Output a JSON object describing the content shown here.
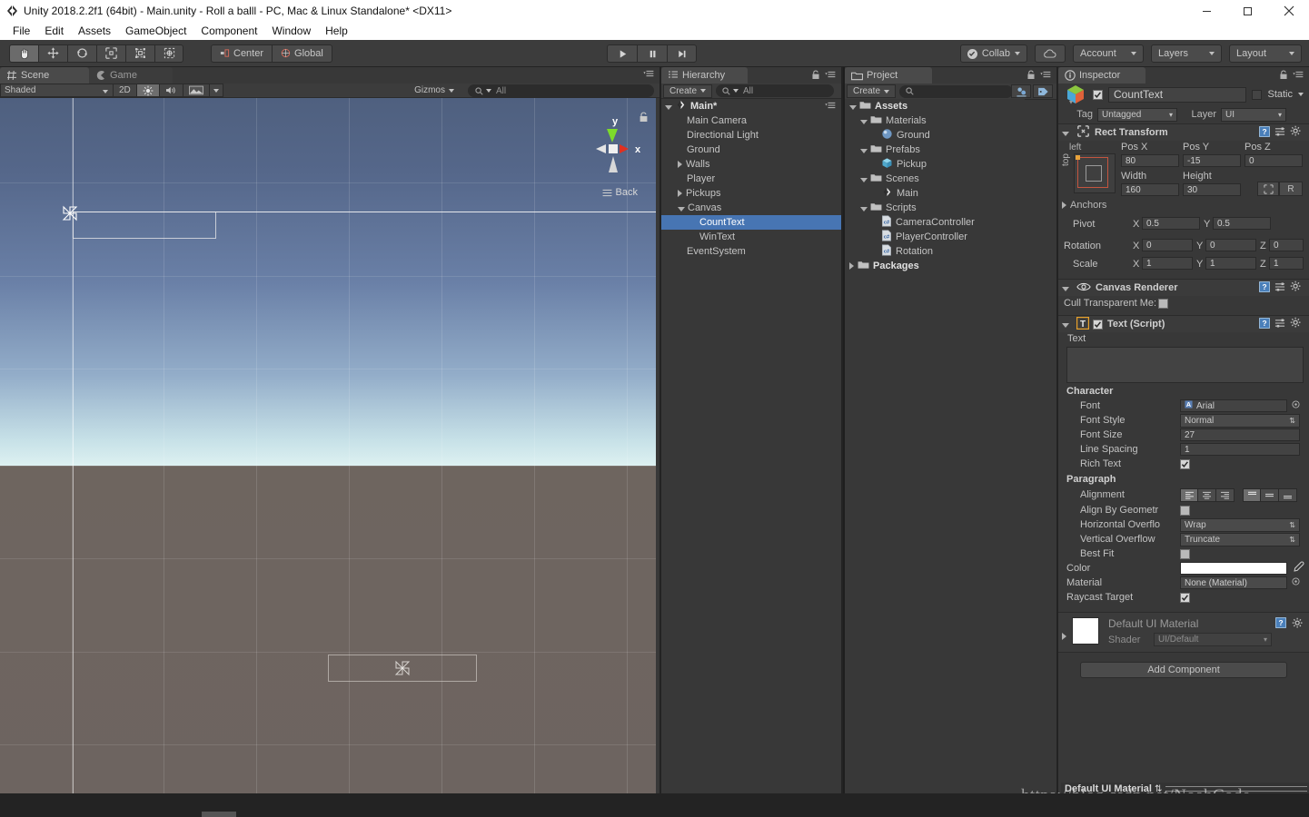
{
  "window": {
    "title": "Unity 2018.2.2f1 (64bit) - Main.unity - Roll a balll - PC, Mac & Linux Standalone* <DX11>",
    "app_icon": "unity-icon",
    "minimize": "minimize-icon",
    "maximize": "maximize-icon",
    "close": "close-icon"
  },
  "menubar": {
    "items": [
      {
        "label": "File"
      },
      {
        "label": "Edit"
      },
      {
        "label": "Assets"
      },
      {
        "label": "GameObject"
      },
      {
        "label": "Component"
      },
      {
        "label": "Window"
      },
      {
        "label": "Help"
      }
    ]
  },
  "toolbar": {
    "tools": [
      {
        "name": "hand-tool",
        "active": true
      },
      {
        "name": "move-tool",
        "active": false
      },
      {
        "name": "rotate-tool",
        "active": false
      },
      {
        "name": "scale-tool",
        "active": false
      },
      {
        "name": "rect-tool",
        "active": false
      },
      {
        "name": "transform-tool",
        "active": false
      }
    ],
    "pivot_label": "Center",
    "space_label": "Global",
    "play": "play-icon",
    "pause": "pause-icon",
    "step": "step-icon",
    "collab_label": "Collab",
    "cloud": "cloud-icon",
    "account_label": "Account",
    "layers_label": "Layers",
    "layout_label": "Layout"
  },
  "scene": {
    "tabs": [
      {
        "label": "Scene",
        "icon": "scene-grid-icon",
        "active": true
      },
      {
        "label": "Game",
        "icon": "game-pacman-icon",
        "active": false
      }
    ],
    "draw_mode": "Shaded",
    "mode_2d": "2D",
    "lighting": "sun-icon",
    "audio": "speaker-icon",
    "fx": "image-icon",
    "gizmos_label": "Gizmos",
    "search_placeholder": "All",
    "orientation_label": "Back",
    "axis_y": "y",
    "axis_x": "x"
  },
  "hierarchy": {
    "tab_label": "Hierarchy",
    "create_label": "Create",
    "search_placeholder": "All",
    "items": [
      {
        "label": "Main*",
        "depth": 0,
        "arrow": "open",
        "icon": "unity-scene-icon",
        "selected": false,
        "bold": true
      },
      {
        "label": "Main Camera",
        "depth": 1,
        "arrow": "none",
        "selected": false
      },
      {
        "label": "Directional Light",
        "depth": 1,
        "arrow": "none",
        "selected": false
      },
      {
        "label": "Ground",
        "depth": 1,
        "arrow": "none",
        "selected": false
      },
      {
        "label": "Walls",
        "depth": 1,
        "arrow": "closed",
        "selected": false
      },
      {
        "label": "Player",
        "depth": 1,
        "arrow": "none",
        "selected": false
      },
      {
        "label": "Pickups",
        "depth": 1,
        "arrow": "closed",
        "selected": false
      },
      {
        "label": "Canvas",
        "depth": 1,
        "arrow": "open",
        "selected": false
      },
      {
        "label": "CountText",
        "depth": 2,
        "arrow": "none",
        "selected": true
      },
      {
        "label": "WinText",
        "depth": 2,
        "arrow": "none",
        "selected": false
      },
      {
        "label": "EventSystem",
        "depth": 1,
        "arrow": "none",
        "selected": false
      }
    ]
  },
  "project": {
    "tab_label": "Project",
    "create_label": "Create",
    "search_placeholder": "",
    "items": [
      {
        "label": "Assets",
        "depth": 0,
        "arrow": "open",
        "icon": "folder-icon",
        "bold": true
      },
      {
        "label": "Materials",
        "depth": 1,
        "arrow": "open",
        "icon": "folder-icon"
      },
      {
        "label": "Ground",
        "depth": 2,
        "arrow": "none",
        "icon": "material-sphere-icon"
      },
      {
        "label": "Prefabs",
        "depth": 1,
        "arrow": "open",
        "icon": "folder-icon"
      },
      {
        "label": "Pickup",
        "depth": 2,
        "arrow": "none",
        "icon": "prefab-cube-icon"
      },
      {
        "label": "Scenes",
        "depth": 1,
        "arrow": "open",
        "icon": "folder-icon"
      },
      {
        "label": "Main",
        "depth": 2,
        "arrow": "none",
        "icon": "unity-scene-icon"
      },
      {
        "label": "Scripts",
        "depth": 1,
        "arrow": "open",
        "icon": "folder-icon"
      },
      {
        "label": "CameraController",
        "depth": 2,
        "arrow": "none",
        "icon": "csharp-script-icon"
      },
      {
        "label": "PlayerController",
        "depth": 2,
        "arrow": "none",
        "icon": "csharp-script-icon"
      },
      {
        "label": "Rotation",
        "depth": 2,
        "arrow": "none",
        "icon": "csharp-script-icon"
      },
      {
        "label": "Packages",
        "depth": 0,
        "arrow": "closed",
        "icon": "folder-icon",
        "bold": true
      }
    ]
  },
  "inspector": {
    "tab_label": "Inspector",
    "object_name": "CountText",
    "object_enabled": true,
    "static_label": "Static",
    "tag_label": "Tag",
    "tag_value": "Untagged",
    "layer_label": "Layer",
    "layer_value": "UI",
    "rect_transform": {
      "title": "Rect Transform",
      "anchor_h_label": "left",
      "anchor_v_label": "top",
      "pos_x_label": "Pos X",
      "pos_y_label": "Pos Y",
      "pos_z_label": "Pos Z",
      "pos_x": "80",
      "pos_y": "-15",
      "pos_z": "0",
      "width_label": "Width",
      "height_label": "Height",
      "width": "160",
      "height": "30",
      "blueprint_btn": "blueprint-icon",
      "raw_btn": "R",
      "anchors_label": "Anchors",
      "pivot_label": "Pivot",
      "pivot_x": "0.5",
      "pivot_y": "0.5",
      "rotation_label": "Rotation",
      "rot_x": "0",
      "rot_y": "0",
      "rot_z": "0",
      "scale_label": "Scale",
      "scale_x": "1",
      "scale_y": "1",
      "scale_z": "1",
      "axis_x": "X",
      "axis_y": "Y",
      "axis_z": "Z"
    },
    "canvas_renderer": {
      "title": "Canvas Renderer",
      "cull_label": "Cull Transparent Me:",
      "cull_checked": false
    },
    "text_script": {
      "title": "Text (Script)",
      "enabled": true,
      "text_label": "Text",
      "text_value": "",
      "character_label": "Character",
      "font_label": "Font",
      "font_value": "Arial",
      "font_style_label": "Font Style",
      "font_style_value": "Normal",
      "font_size_label": "Font Size",
      "font_size_value": "27",
      "line_spacing_label": "Line Spacing",
      "line_spacing_value": "1",
      "rich_text_label": "Rich Text",
      "rich_text_checked": true,
      "paragraph_label": "Paragraph",
      "alignment_label": "Alignment",
      "align_h_selected": 0,
      "align_v_selected": 0,
      "align_by_geometry_label": "Align By Geometr",
      "align_by_geometry_checked": false,
      "horizontal_overflow_label": "Horizontal Overflo",
      "horizontal_overflow_value": "Wrap",
      "vertical_overflow_label": "Vertical Overflow",
      "vertical_overflow_value": "Truncate",
      "best_fit_label": "Best Fit",
      "best_fit_checked": false,
      "color_label": "Color",
      "color_value": "#ffffff",
      "material_label": "Material",
      "material_value": "None (Material)",
      "raycast_target_label": "Raycast Target",
      "raycast_target_checked": true
    },
    "material": {
      "title": "Default UI Material",
      "shader_label": "Shader",
      "shader_value": "UI/Default"
    },
    "add_component_label": "Add Component"
  },
  "status": {
    "material_bar_label": "Default UI Material",
    "watermark": "https://blog.csdn.net/NoahCode"
  },
  "colors": {
    "selection_blue": "#4775b3",
    "panel_bg": "#383838",
    "toolbar_bg": "#3c3c3c",
    "text": "#c4c4c4",
    "axis_x_red": "#e03020",
    "axis_y_green": "#7ddb2a"
  }
}
